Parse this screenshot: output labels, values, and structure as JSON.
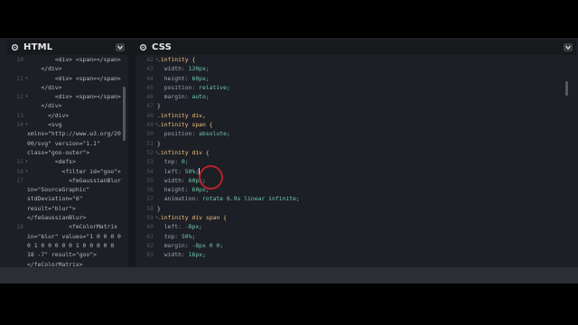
{
  "colors": {
    "background": "#000000",
    "editor_bg": "#1d1f26",
    "selector": "#f0c27a",
    "string": "#88c98f",
    "property": "#9aa3b5",
    "value": "#6fc9a8",
    "cursor_ring": "#b8232a"
  },
  "html_panel": {
    "title": "HTML",
    "lines": [
      {
        "n": "10",
        "fold": "",
        "text": "        <div> <span></span>"
      },
      {
        "n": "",
        "fold": "",
        "text": "    </div>"
      },
      {
        "n": "11",
        "fold": "▾",
        "text": "        <div> <span></span>"
      },
      {
        "n": "",
        "fold": "",
        "text": "    </div>"
      },
      {
        "n": "12",
        "fold": "▾",
        "text": "        <div> <span></span>"
      },
      {
        "n": "",
        "fold": "",
        "text": "    </div>"
      },
      {
        "n": "13",
        "fold": "",
        "text": "      </div>"
      },
      {
        "n": "14",
        "fold": "▾",
        "text": "      <svg"
      },
      {
        "n": "",
        "fold": "",
        "text": "xmlns=\"http://www.w3.org/20"
      },
      {
        "n": "",
        "fold": "",
        "text": "00/svg\" version=\"1.1\""
      },
      {
        "n": "",
        "fold": "",
        "text": "class=\"goo-outer\">"
      },
      {
        "n": "15",
        "fold": "▾",
        "text": "        <defs>"
      },
      {
        "n": "16",
        "fold": "▾",
        "text": "          <filter id=\"goo\">"
      },
      {
        "n": "17",
        "fold": "",
        "text": "            <feGaussianBlur"
      },
      {
        "n": "",
        "fold": "",
        "text": "in=\"SourceGraphic\""
      },
      {
        "n": "",
        "fold": "",
        "text": "stdDeviation=\"6\""
      },
      {
        "n": "",
        "fold": "",
        "text": "result=\"blur\">"
      },
      {
        "n": "",
        "fold": "",
        "text": "</feGaussianBlur>"
      },
      {
        "n": "18",
        "fold": "",
        "text": "            <feColorMatrix"
      },
      {
        "n": "",
        "fold": "",
        "text": "in=\"blur\" values=\"1 0 0 0 0"
      },
      {
        "n": "",
        "fold": "",
        "text": "0 1 0 0 0 0 0 1 0 0 0 0 0"
      },
      {
        "n": "",
        "fold": "",
        "text": "18 -7\" result=\"goo\">"
      },
      {
        "n": "",
        "fold": "",
        "text": "</feColorMatrix>"
      }
    ]
  },
  "css_panel": {
    "title": "CSS",
    "lines": [
      {
        "n": "42",
        "fold": "▾",
        "sel": ".infinity {",
        "prop": "",
        "val": ""
      },
      {
        "n": "43",
        "fold": "",
        "sel": "",
        "prop": "  width: ",
        "val": "120px;"
      },
      {
        "n": "44",
        "fold": "",
        "sel": "",
        "prop": "  height: ",
        "val": "60px;"
      },
      {
        "n": "45",
        "fold": "",
        "sel": "",
        "prop": "  position: ",
        "val": "relative;"
      },
      {
        "n": "46",
        "fold": "",
        "sel": "",
        "prop": "  margin: ",
        "val": "auto;"
      },
      {
        "n": "47",
        "fold": "",
        "sel": "}",
        "prop": "",
        "val": ""
      },
      {
        "n": "48",
        "fold": "",
        "sel": ".infinity div,",
        "prop": "",
        "val": ""
      },
      {
        "n": "49",
        "fold": "▾",
        "sel": ".infinity span {",
        "prop": "",
        "val": ""
      },
      {
        "n": "50",
        "fold": "",
        "sel": "",
        "prop": "  position: ",
        "val": "absolute;"
      },
      {
        "n": "51",
        "fold": "",
        "sel": "}",
        "prop": "",
        "val": ""
      },
      {
        "n": "52",
        "fold": "▾",
        "sel": ".infinity div {",
        "prop": "",
        "val": ""
      },
      {
        "n": "53",
        "fold": "",
        "sel": "",
        "prop": "  top: ",
        "val": "0;"
      },
      {
        "n": "54",
        "fold": "",
        "sel": "",
        "prop": "  left: ",
        "val": "50%;"
      },
      {
        "n": "55",
        "fold": "",
        "sel": "",
        "prop": "  width: ",
        "val": "60px;"
      },
      {
        "n": "56",
        "fold": "",
        "sel": "",
        "prop": "  height: ",
        "val": "60px;"
      },
      {
        "n": "57",
        "fold": "",
        "sel": "",
        "prop": "  animation: ",
        "val": "rotate 6.9s linear infinite;"
      },
      {
        "n": "58",
        "fold": "",
        "sel": "}",
        "prop": "",
        "val": ""
      },
      {
        "n": "59",
        "fold": "▾",
        "sel": ".infinity div span {",
        "prop": "",
        "val": ""
      },
      {
        "n": "60",
        "fold": "",
        "sel": "",
        "prop": "  left: ",
        "val": "-8px;"
      },
      {
        "n": "61",
        "fold": "",
        "sel": "",
        "prop": "  top: ",
        "val": "50%;"
      },
      {
        "n": "62",
        "fold": "",
        "sel": "",
        "prop": "  margin: ",
        "val": "-8px 0 0;"
      },
      {
        "n": "63",
        "fold": "",
        "sel": "",
        "prop": "  width: ",
        "val": "16px;"
      }
    ]
  }
}
